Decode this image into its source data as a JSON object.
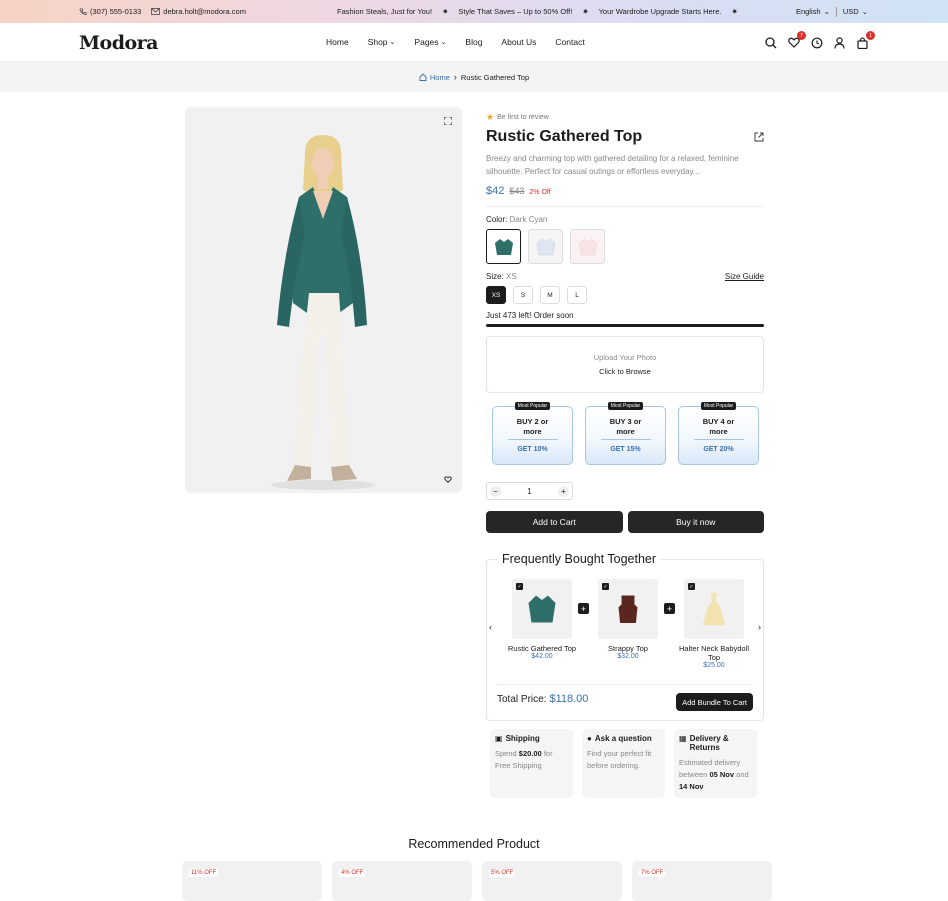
{
  "topbar": {
    "phone": "(307) 555-0133",
    "email": "debra.holt@modora.com",
    "promos": [
      "Fashion Steals, Just for You!",
      "Style That Saves – Up to 50% Off!",
      "Your Wardrobe Upgrade Starts Here."
    ],
    "language": "English",
    "currency": "USD"
  },
  "header": {
    "logo": "Modora",
    "nav": [
      "Home",
      "Shop",
      "Pages",
      "Blog",
      "About Us",
      "Contact"
    ],
    "wishlist_count": "7",
    "cart_count": "1"
  },
  "breadcrumb": {
    "home": "Home",
    "current": "Rustic Gathered Top"
  },
  "product": {
    "review_text": "Be first to review",
    "title": "Rustic Gathered Top",
    "description": "Breezy and charming top with gathered detailing for a relaxed, feminine silhouette. Perfect for casual outings or effortless everyday...",
    "price": "$42",
    "old_price": "$43",
    "discount": "2% Off",
    "color_label": "Color:",
    "color_value": "Dark Cyan",
    "size_label": "Size:",
    "size_value": "XS",
    "size_guide": "Size Guide",
    "sizes": [
      "XS",
      "S",
      "M",
      "L"
    ],
    "stock_text": "Just 473 left! Order soon",
    "stock_fraction": 1.0,
    "upload_title": "Upload Your Photo",
    "upload_action": "Click to Browse",
    "quantity": "1",
    "add_to_cart": "Add to Cart",
    "buy_now": "Buy it now"
  },
  "offers": [
    {
      "tag": "Most Popular",
      "title": "BUY 2 or more",
      "get": "GET 10%"
    },
    {
      "tag": "Most Popular",
      "title": "BUY 3 or more",
      "get": "GET 15%"
    },
    {
      "tag": "Most Popular",
      "title": "BUY 4 or more",
      "get": "GET 20%"
    }
  ],
  "fbt": {
    "heading": "Frequently Bought Together",
    "items": [
      {
        "name": "Rustic Gathered Top",
        "price": "$42.00"
      },
      {
        "name": "Strappy Top",
        "price": "$32.00"
      },
      {
        "name": "Halter Neck Babydoll Top",
        "price": "$25.00"
      }
    ],
    "total_label": "Total Price:",
    "total": "$118.00",
    "bundle_button": "Add Bundle To Cart"
  },
  "info_cards": [
    {
      "title": "Shipping",
      "text_pre": "Spend",
      "bold": "$20.00",
      "text_post": "for Free Shipping"
    },
    {
      "title": "Ask a question",
      "text": "Find your perfect fit before ordering."
    },
    {
      "title": "Delivery & Returns",
      "text_pre": "Estimated delivery between",
      "bold1": "05 Nov",
      "mid": "and",
      "bold2": "14 Nov"
    }
  ],
  "recommended": {
    "heading": "Recommended Product",
    "badges": [
      "11% OFF",
      "4% OFF",
      "5% OFF",
      "7% OFF"
    ]
  }
}
